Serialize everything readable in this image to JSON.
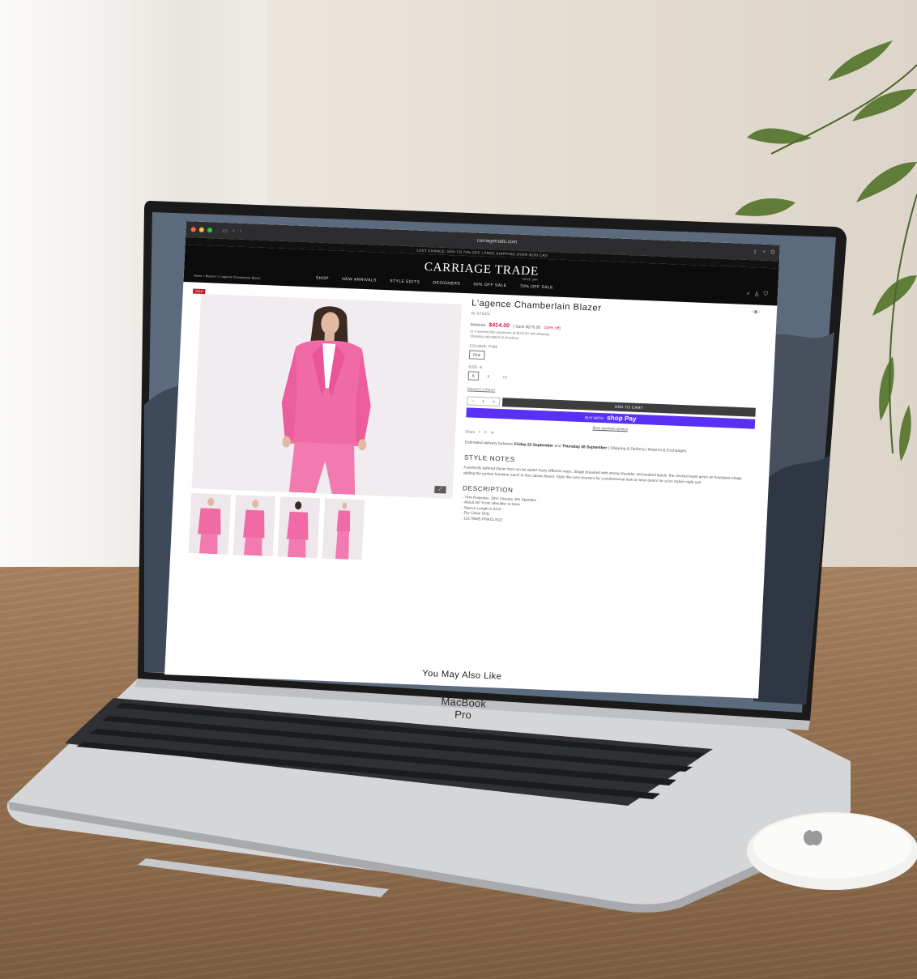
{
  "scene": {
    "laptop_label": "MacBook Pro"
  },
  "browser": {
    "url": "carriagetrade.com"
  },
  "site": {
    "promo_bar": "LAST CHANCE: 50% TO 70% OFF | FREE SHIPPING OVER $150 CAD",
    "logo": "CARRIAGE TRADE",
    "logo_sub": "SINCE 1964",
    "nav": [
      "SHOP",
      "NEW ARRIVALS",
      "STYLE EDITS",
      "DESIGNERS",
      "50% OFF SALE",
      "70% OFF SALE"
    ],
    "breadcrumb": "Home > Blazers > L'agence Chamberlain Blazer"
  },
  "product": {
    "sale_badge": "SALE",
    "title": "L'agence Chamberlain Blazer",
    "stock": "IN STOCK",
    "price_old": "$690.00",
    "price_new": "$414.00",
    "price_save": "| Save $276.00",
    "price_pct": "(40% off)",
    "afterpay": "or 4 interest-free payments of $103.50 with Afterpay",
    "shipping_note": "Shipping calculated at checkout.",
    "colour_label": "COLOUR: PINK",
    "colour_value": "Pink",
    "size_label": "SIZE: 6",
    "sizes": [
      "6",
      "8",
      "10"
    ],
    "sizes_link": "Measure a Blazer",
    "qty_value": "1",
    "add_to_cart": "ADD TO CART",
    "buy_with": "BUY WITH",
    "shop_pay": "shop Pay",
    "more_payment": "More payment options",
    "share": "Share",
    "delivery_text": "Estimated delivery between",
    "delivery_start": "Friday 22 September",
    "delivery_and": "and",
    "delivery_end": "Thursday 28 September",
    "delivery_links": "| Shipping & Delivery | Returns & Exchanges",
    "style_notes_heading": "STYLE NOTES",
    "style_notes": "A perfectly tailored blazer that can be styled many different ways. Single breasted with strong shoulder and peaked lapels, the cinched waist gives an hourglass shape adding the perfect feminine touch to this classic blazer. Style this over trousers for a professional look or wear denim for a fun stylish night out!",
    "description_heading": "DESCRIPTION",
    "description": [
      "- 74% Polyester, 20% Viscose, 6% Spandex",
      "- About 26\" From Shoulder to Hem",
      "- Sleeve Length is 24.5\"",
      "- Dry Clean Only",
      "- 1317NWE-PNKCL/S22"
    ],
    "you_may_also_like": "You May Also Like"
  },
  "colors": {
    "accent_pink": "#d31e47",
    "shop_pay": "#5a31f4",
    "header_bg": "#0c0c0c",
    "blazer": "#f06aa6"
  },
  "icons": [
    "search-icon",
    "account-icon",
    "cart-icon",
    "share-facebook-icon",
    "share-pinterest-icon",
    "share-email-icon",
    "zoom-icon",
    "apple-logo-icon"
  ]
}
